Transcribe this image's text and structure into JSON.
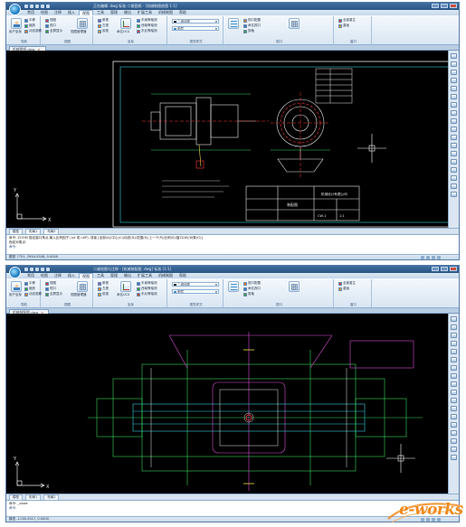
{
  "top_window": {
    "title": "正在编辑 .dwg 标准-二维图纸 - [机械制图底图 1:1]",
    "menu": [
      "常用",
      "绘图",
      "注释",
      "插入",
      "视图",
      "工具",
      "管理",
      "输出",
      "扩展工具",
      "机械制图",
      "帮助"
    ],
    "active_menu": "视图",
    "ribbon": {
      "buttons": {
        "user_ucs": "用户坐标",
        "view_mgr": "视图管理器",
        "ucs": "命名UCS",
        "layer_props": "图层"
      },
      "rows_a": [
        "平移",
        "缩放",
        "动态观察"
      ],
      "rows_b": [
        "视图",
        "视口",
        "全屏显示"
      ],
      "rows_c": [
        "俯视",
        "左视",
        "前视"
      ],
      "rows_d": [
        "东南等轴测",
        "西南等轴测",
        "东北等轴测"
      ],
      "layer_combo": "二维线框",
      "rows_e": [
        "视口配置",
        "命名视口",
        "剪裁"
      ],
      "rows_f": [
        "全部重生",
        "重画"
      ],
      "group_labels": [
        "导航",
        "视图",
        "坐标",
        "视觉样式",
        "视口",
        "窗口"
      ]
    },
    "doc_tab": "机械图纸.dwg",
    "layout_tabs": [
      "模型",
      "布局1",
      "布局2"
    ],
    "cmd_lines": [
      "命令: ZOOM 指定窗口角点,输入比例因子 (nX 或 nXP), 或者 [全部(A)/中心(C)/动态(D)/范围(E)/上一个(P)/比例(S)/窗口(W)/对象(O)]",
      "指定对角点:",
      "命令:"
    ],
    "status": "模型  7751, 2954.5508, 0.0000",
    "title_block": {
      "company": "机械设计有限公司",
      "name": "装配图",
      "scale": "1:1",
      "drawing_no": "CW-1"
    }
  },
  "bottom_window": {
    "title": "二维绘图与注释 - [机械装配图 .dwg] 标准 (1:1)",
    "menu": [
      "常用",
      "绘图",
      "注释",
      "插入",
      "视图",
      "工具",
      "管理",
      "输出",
      "扩展工具",
      "机械制图",
      "帮助"
    ],
    "active_menu": "视图",
    "doc_tab": "机械装配图.dwg",
    "layout_tabs": [
      "模型",
      "布局1",
      "布局2"
    ],
    "cmd_lines": [
      "命令: _close",
      "命令:"
    ],
    "status": "模型  -1138.3317, 0.0000"
  },
  "watermark": {
    "text": "e-works"
  },
  "colors": {
    "canvas": "#000000",
    "ribbon_top": "#f4f8fc",
    "titlebar": "#2a5585",
    "drawing_white": "#e8e8e8",
    "drawing_cyan": "#35d0e0",
    "drawing_green": "#39d65a",
    "drawing_magenta": "#d84cd4",
    "drawing_red": "#ff3b3b",
    "drawing_yellow": "#f0e040",
    "watermark_orange": "#f08a1c"
  },
  "icons": [
    "app-logo-icon",
    "user-ucs-icon",
    "axis-icon",
    "layer-icon",
    "grid-icon",
    "crosshair-icon",
    "ucs-axis-icon",
    "close-icon"
  ]
}
